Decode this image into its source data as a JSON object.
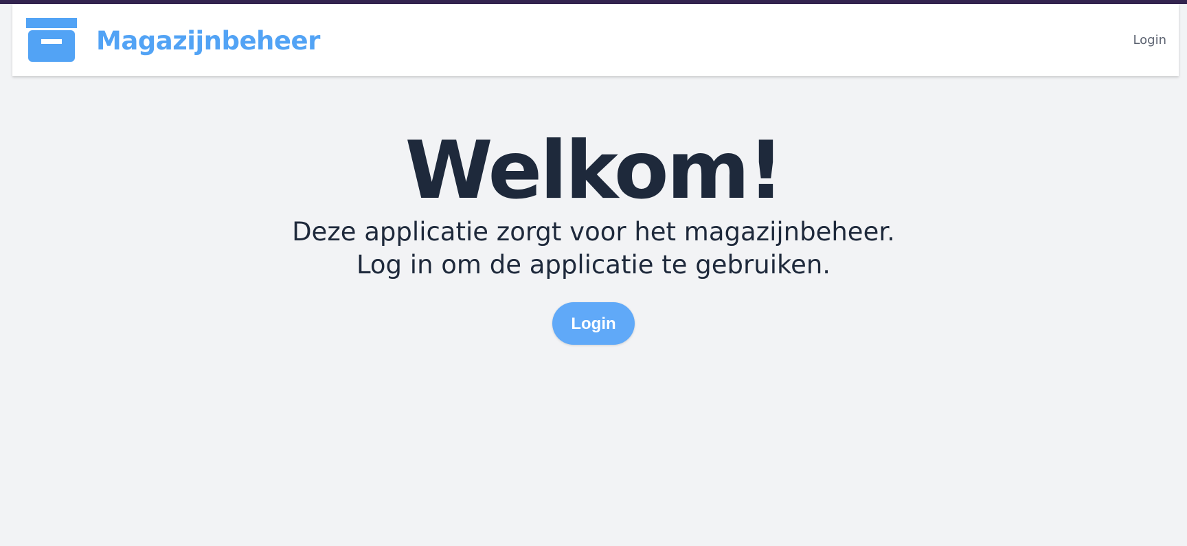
{
  "theme": {
    "accent": "#52a3f5",
    "button_bg": "#60a9f8",
    "text_dark": "#1e293b",
    "page_bg": "#f2f3f5",
    "top_strip": "#33244f"
  },
  "navbar": {
    "logo_icon": "archive-box-icon",
    "brand": "Magazijnbeheer",
    "login_link": "Login"
  },
  "hero": {
    "title": "Welkom!",
    "line1": "Deze applicatie zorgt voor het magazijnbeheer.",
    "line2": "Log in om de applicatie te gebruiken.",
    "button": "Login"
  }
}
